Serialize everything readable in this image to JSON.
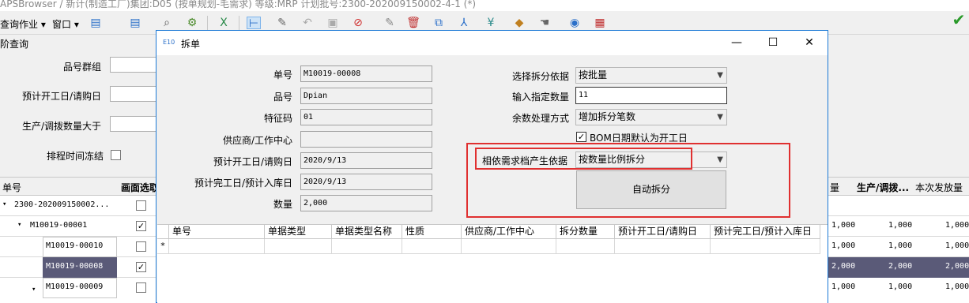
{
  "app": {
    "title": "APSBrowser / 新计(制造工厂)集团:D05 (按单规划-毛需求) 等级:MRP 计划批号:2300-202009150002-4-1 (*)"
  },
  "toolbar": {
    "query_menu": "查询作业 ▾",
    "window_menu": "窗口 ▾"
  },
  "query": {
    "title": "阶查询",
    "product_group_label": "品号群组",
    "start_date_label": "预计开工日/请购日",
    "qty_label": "生产/调拨数量大于",
    "freeze_label": "排程时间冻结"
  },
  "grid": {
    "headers": [
      "单号",
      "画面选取",
      "量",
      "生产/调拨...",
      "本次发放量"
    ],
    "rows": [
      {
        "id": "2300-202009150002...",
        "checked": false,
        "qty1": "",
        "qty2": "",
        "qty3": ""
      },
      {
        "id": "M10019-00001",
        "checked": true,
        "qty1": "1,000",
        "qty2": "1,000",
        "qty3": "1,000"
      },
      {
        "id": "M10019-00010",
        "checked": false,
        "qty1": "1,000",
        "qty2": "1,000",
        "qty3": "1,000"
      },
      {
        "id": "M10019-00008",
        "checked": true,
        "qty1": "2,000",
        "qty2": "2,000",
        "qty3": "2,000"
      },
      {
        "id": "M10019-00009",
        "checked": false,
        "qty1": "1,000",
        "qty2": "1,000",
        "qty3": "1,000"
      }
    ]
  },
  "dialog": {
    "title": "拆单",
    "icon_text": "E10",
    "order_no_label": "单号",
    "order_no": "M10019-00008",
    "product_label": "品号",
    "product": "Dpian",
    "feature_label": "特征码",
    "feature": "01",
    "supplier_label": "供应商/工作中心",
    "supplier": "",
    "start_label": "预计开工日/请购日",
    "start_date": "2020/9/13",
    "end_label": "预计完工日/预计入库日",
    "end_date": "2020/9/13",
    "qty_label": "数量",
    "qty": "2,000",
    "split_basis_label": "选择拆分依据",
    "split_basis": "按批量",
    "input_qty_label": "输入指定数量",
    "input_qty": "11",
    "remainder_label": "余数处理方式",
    "remainder": "增加拆分笔数",
    "bom_checkbox_label": "BOM日期默认为开工日",
    "bom_checked": true,
    "demand_basis_label": "相依需求档产生依据",
    "demand_basis": "按数量比例拆分",
    "auto_split_button": "自动拆分",
    "subgrid_headers": [
      "单号",
      "单据类型",
      "单据类型名称",
      "性质",
      "供应商/工作中心",
      "拆分数量",
      "预计开工日/请购日",
      "预计完工日/预计入库日"
    ],
    "new_row_marker": "*"
  },
  "colors": {
    "highlight_box": "#e03030",
    "dialog_border": "#1c7ad6",
    "selected_row": "#5a5a78"
  }
}
